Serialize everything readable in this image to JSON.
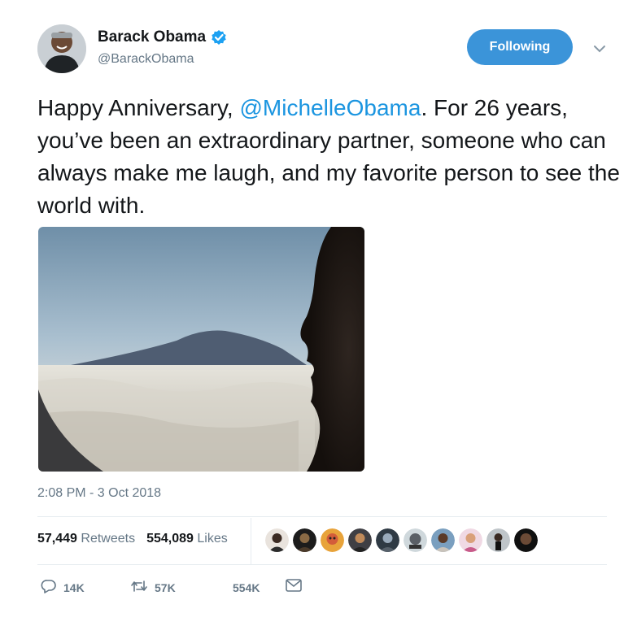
{
  "author": {
    "name": "Barack Obama",
    "handle": "@BarackObama",
    "verified": true
  },
  "follow_button": {
    "label": "Following"
  },
  "tweet": {
    "text_before_mention": "Happy Anniversary, ",
    "mention": "@MichelleObama",
    "text_after_mention": ". For 26 years, you’ve been an extraordinary partner, someone who can always make me laugh, and my favorite person to see the world with."
  },
  "timestamp": "2:08 PM - 3 Oct 2018",
  "stats": {
    "retweets_count": "57,449",
    "retweets_label": "Retweets",
    "likes_count": "554,089",
    "likes_label": "Likes"
  },
  "actions": {
    "reply_count": "14K",
    "retweet_count": "57K",
    "like_count": "554K"
  },
  "colors": {
    "accent": "#1b95e0",
    "follow_button": "#3b94d9",
    "muted_text": "#657786"
  }
}
